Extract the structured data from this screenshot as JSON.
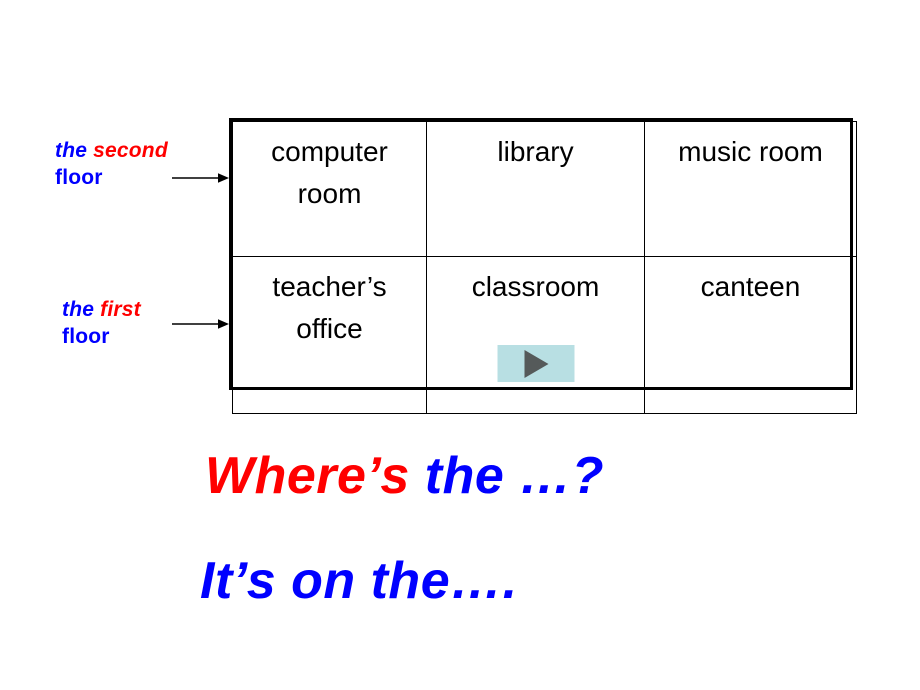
{
  "floor_labels": [
    {
      "id": "second",
      "the": "the ",
      "ordinal": "second",
      "floor": "floor",
      "arrow_icon": "arrow-right-icon"
    },
    {
      "id": "first",
      "the": "the ",
      "ordinal": "first",
      "floor": "floor",
      "arrow_icon": "arrow-right-icon"
    }
  ],
  "table": {
    "rows": [
      {
        "name": "second-floor-row",
        "cells": [
          {
            "label": "computer room"
          },
          {
            "label": "library"
          },
          {
            "label": "music room"
          }
        ]
      },
      {
        "name": "first-floor-row",
        "cells": [
          {
            "label": "teacher’s office"
          },
          {
            "label": "classroom",
            "has_play_button": true
          },
          {
            "label": "canteen"
          }
        ]
      }
    ]
  },
  "media": {
    "play_button_icon": "play-triangle-icon",
    "play_button_bg": "#b8dfe3",
    "play_triangle_color": "#555a5a"
  },
  "prompts": {
    "question": {
      "red_part": "Where’s",
      "blue_part": " the …?"
    },
    "answer": {
      "blue_part": "It’s on the…."
    }
  },
  "colors": {
    "red": "#ff0000",
    "blue": "#0000ff",
    "black": "#000000",
    "background": "#ffffff"
  }
}
